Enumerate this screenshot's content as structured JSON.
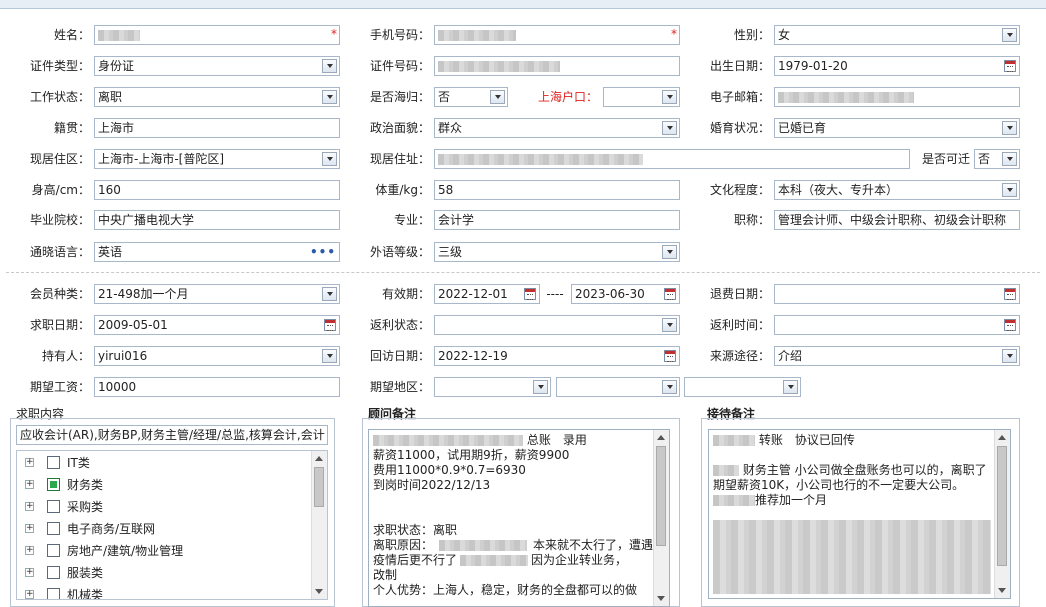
{
  "form": {
    "row1": {
      "name_label": "姓名：",
      "phone_label": "手机号码：",
      "gender_label": "性别：",
      "gender_value": "女"
    },
    "row2": {
      "idtype_label": "证件类型：",
      "idtype_value": "身份证",
      "idno_label": "证件号码：",
      "birth_label": "出生日期：",
      "birth_value": "1979-01-20"
    },
    "row3": {
      "workstatus_label": "工作状态：",
      "workstatus_value": "离职",
      "overseas_label": "是否海归：",
      "overseas_value": "否",
      "hukou_label": "上海户口：",
      "email_label": "电子邮箱："
    },
    "row4": {
      "native_label": "籍贯：",
      "native_value": "上海市",
      "politics_label": "政治面貌：",
      "politics_value": "群众",
      "marital_label": "婚育状况：",
      "marital_value": "已婚已育"
    },
    "row5": {
      "region_label": "现居住区：",
      "region_value": "上海市-上海市-[普陀区]",
      "address_label": "现居住址：",
      "relocate_label": "是否可迁",
      "relocate_value": "否"
    },
    "row6": {
      "height_label": "身高/cm：",
      "height_value": "160",
      "weight_label": "体重/kg：",
      "weight_value": "58",
      "education_label": "文化程度：",
      "education_value": "本科（夜大、专升本）"
    },
    "row7": {
      "school_label": "毕业院校：",
      "school_value": "中央广播电视大学",
      "major_label": "专业：",
      "major_value": "会计学",
      "title_label": "职称：",
      "title_value": "管理会计师、中级会计职称、初级会计职称"
    },
    "row8": {
      "lang_label": "通晓语言：",
      "lang_value": "英语",
      "lang_more": "•••",
      "level_label": "外语等级：",
      "level_value": "三级"
    },
    "row9": {
      "member_label": "会员种类：",
      "member_value": "21-498加一个月",
      "valid_label": "有效期：",
      "valid_from": "2022-12-01",
      "valid_sep": "----",
      "valid_to": "2023-06-30",
      "refund_label": "退费日期："
    },
    "row10": {
      "jobdate_label": "求职日期：",
      "jobdate_value": "2009-05-01",
      "rebate_label": "返利状态：",
      "rebatetime_label": "返利时间："
    },
    "row11": {
      "holder_label": "持有人：",
      "holder_value": "yirui016",
      "visit_label": "回访日期：",
      "visit_value": "2022-12-19",
      "source_label": "来源途径：",
      "source_value": "介绍"
    },
    "row12": {
      "salary_label": "期望工资：",
      "salary_value": "10000",
      "area_label": "期望地区："
    }
  },
  "job_panel": {
    "title": "求职内容",
    "summary": "应收会计(AR),财务BP,财务主管/经理/总监,核算会计,会计",
    "items": [
      {
        "label": "IT类",
        "checked": false
      },
      {
        "label": "财务类",
        "checked": true
      },
      {
        "label": "采购类",
        "checked": false
      },
      {
        "label": "电子商务/互联网",
        "checked": false
      },
      {
        "label": "房地产/建筑/物业管理",
        "checked": false
      },
      {
        "label": "服装类",
        "checked": false
      },
      {
        "label": "机械类",
        "checked": false
      }
    ]
  },
  "consultant_panel": {
    "title": "顾问备注",
    "lines": [
      {
        "pre": "",
        "post": "总账　录用"
      },
      {
        "pre": "薪资11000，试用期9折，薪资9900",
        "post": ""
      },
      {
        "pre": "费用11000*0.9*0.7=6930",
        "post": ""
      },
      {
        "pre": "到岗时间2022/12/13",
        "post": ""
      },
      {
        "pre": "",
        "post": ""
      },
      {
        "pre": "求职状态：离职",
        "post": ""
      },
      {
        "pre": "离职原因：",
        "post": "本来就不太行了，遭遇"
      },
      {
        "pre": "疫情后更不行了",
        "post": "因为企业转业务，"
      },
      {
        "pre": "改制",
        "post": ""
      },
      {
        "pre": "个人优势：上海人，稳定，财务的全盘都可以的做",
        "post": ""
      }
    ]
  },
  "reception_panel": {
    "title": "接待备注",
    "line1": "转账　协议已回传",
    "line2a": "财务主管 小公司做全盘账务也可以的，离职了",
    "line2b": "期望薪资10K，小公司也行的不一定要大公司。",
    "line2c": "推荐加一个月"
  }
}
